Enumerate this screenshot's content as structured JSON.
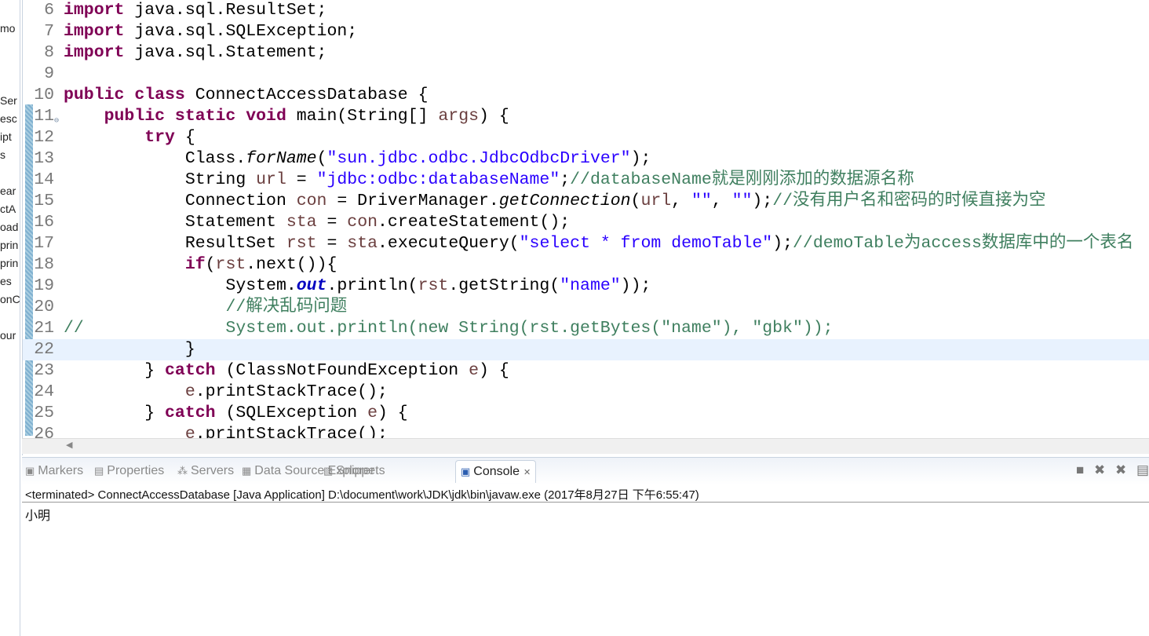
{
  "explorer_fragments": [
    "mo",
    "Ser",
    "esc",
    "ipt",
    "s",
    "ear",
    "ctA",
    "oad",
    "prin",
    "prin",
    "es",
    "onC",
    "our"
  ],
  "editor": {
    "current_line": 22,
    "lines": [
      {
        "n": "6",
        "t": [
          [
            "kw",
            "import"
          ],
          [
            "pl",
            " java.sql.ResultSet;"
          ]
        ]
      },
      {
        "n": "7",
        "t": [
          [
            "kw",
            "import"
          ],
          [
            "pl",
            " java.sql.SQLException;"
          ]
        ]
      },
      {
        "n": "8",
        "t": [
          [
            "kw",
            "import"
          ],
          [
            "pl",
            " java.sql.Statement;"
          ]
        ]
      },
      {
        "n": "9",
        "t": []
      },
      {
        "n": "10",
        "t": [
          [
            "kw",
            "public class"
          ],
          [
            "pl",
            " ConnectAccessDatabase {"
          ]
        ]
      },
      {
        "n": "11",
        "t": [
          [
            "pl",
            "    "
          ],
          [
            "kw",
            "public static void"
          ],
          [
            "pl",
            " main(String[] "
          ],
          [
            "var",
            "args"
          ],
          [
            "pl",
            ") {"
          ]
        ]
      },
      {
        "n": "12",
        "t": [
          [
            "pl",
            "        "
          ],
          [
            "kw",
            "try"
          ],
          [
            "pl",
            " {"
          ]
        ]
      },
      {
        "n": "13",
        "t": [
          [
            "pl",
            "            Class."
          ],
          [
            "sm",
            "forName"
          ],
          [
            "pl",
            "("
          ],
          [
            "str",
            "\"sun.jdbc.odbc.JdbcOdbcDriver\""
          ],
          [
            "pl",
            ");"
          ]
        ]
      },
      {
        "n": "14",
        "t": [
          [
            "pl",
            "            String "
          ],
          [
            "var",
            "url"
          ],
          [
            "pl",
            " = "
          ],
          [
            "str",
            "\"jdbc:odbc:databaseName\""
          ],
          [
            "pl",
            ";"
          ],
          [
            "com",
            "//databaseName就是刚刚添加的数据源名称"
          ]
        ]
      },
      {
        "n": "15",
        "t": [
          [
            "pl",
            "            Connection "
          ],
          [
            "var",
            "con"
          ],
          [
            "pl",
            " = DriverManager."
          ],
          [
            "sm",
            "getConnection"
          ],
          [
            "pl",
            "("
          ],
          [
            "var",
            "url"
          ],
          [
            "pl",
            ", "
          ],
          [
            "str",
            "\"\""
          ],
          [
            "pl",
            ", "
          ],
          [
            "str",
            "\"\""
          ],
          [
            "pl",
            ");"
          ],
          [
            "com",
            "//没有用户名和密码的时候直接为空"
          ]
        ]
      },
      {
        "n": "16",
        "t": [
          [
            "pl",
            "            Statement "
          ],
          [
            "var",
            "sta"
          ],
          [
            "pl",
            " = "
          ],
          [
            "var",
            "con"
          ],
          [
            "pl",
            ".createStatement();"
          ]
        ]
      },
      {
        "n": "17",
        "t": [
          [
            "pl",
            "            ResultSet "
          ],
          [
            "var",
            "rst"
          ],
          [
            "pl",
            " = "
          ],
          [
            "var",
            "sta"
          ],
          [
            "pl",
            ".executeQuery("
          ],
          [
            "str",
            "\"select * from demoTable\""
          ],
          [
            "pl",
            ");"
          ],
          [
            "com",
            "//demoTable为access数据库中的一个表名"
          ]
        ]
      },
      {
        "n": "18",
        "t": [
          [
            "pl",
            "            "
          ],
          [
            "kw",
            "if"
          ],
          [
            "pl",
            "("
          ],
          [
            "var",
            "rst"
          ],
          [
            "pl",
            ".next()){"
          ]
        ]
      },
      {
        "n": "19",
        "t": [
          [
            "pl",
            "                System."
          ],
          [
            "fld",
            "out"
          ],
          [
            "pl",
            ".println("
          ],
          [
            "var",
            "rst"
          ],
          [
            "pl",
            ".getString("
          ],
          [
            "str",
            "\"name\""
          ],
          [
            "pl",
            "));"
          ]
        ]
      },
      {
        "n": "20",
        "t": [
          [
            "pl",
            "                "
          ],
          [
            "com",
            "//解决乱码问题"
          ]
        ]
      },
      {
        "n": "21",
        "t": [
          [
            "com",
            "//              System.out.println(new String(rst.getBytes(\"name\"), \"gbk\"));"
          ]
        ]
      },
      {
        "n": "22",
        "t": [
          [
            "pl",
            "            }"
          ]
        ]
      },
      {
        "n": "23",
        "t": [
          [
            "pl",
            "        } "
          ],
          [
            "kw",
            "catch"
          ],
          [
            "pl",
            " (ClassNotFoundException "
          ],
          [
            "var",
            "e"
          ],
          [
            "pl",
            ") {"
          ]
        ]
      },
      {
        "n": "24",
        "t": [
          [
            "pl",
            "            "
          ],
          [
            "var",
            "e"
          ],
          [
            "pl",
            ".printStackTrace();"
          ]
        ]
      },
      {
        "n": "25",
        "t": [
          [
            "pl",
            "        } "
          ],
          [
            "kw",
            "catch"
          ],
          [
            "pl",
            " (SQLException "
          ],
          [
            "var",
            "e"
          ],
          [
            "pl",
            ") {"
          ]
        ]
      },
      {
        "n": "26",
        "t": [
          [
            "pl",
            "            "
          ],
          [
            "var",
            "e"
          ],
          [
            "pl",
            ".printStackTrace();"
          ]
        ]
      }
    ]
  },
  "panel": {
    "tabs": [
      {
        "label": "Markers",
        "icon": "markers-icon",
        "glyph": "▣"
      },
      {
        "label": "Properties",
        "icon": "properties-icon",
        "glyph": "▤"
      },
      {
        "label": "Servers",
        "icon": "servers-icon",
        "glyph": "⁂"
      },
      {
        "label": "Data Source Explorer",
        "icon": "data-source-icon",
        "glyph": "▦"
      },
      {
        "label": "Snippets",
        "icon": "snippets-icon",
        "glyph": "▧"
      },
      {
        "label": "Console",
        "icon": "console-icon",
        "glyph": "▣",
        "active": true
      }
    ],
    "close_glyph": "✕",
    "status": "<terminated> ConnectAccessDatabase [Java Application] D:\\document\\work\\JDK\\jdk\\bin\\javaw.exe (2017年8月27日 下午6:55:47)",
    "output": "小明"
  }
}
